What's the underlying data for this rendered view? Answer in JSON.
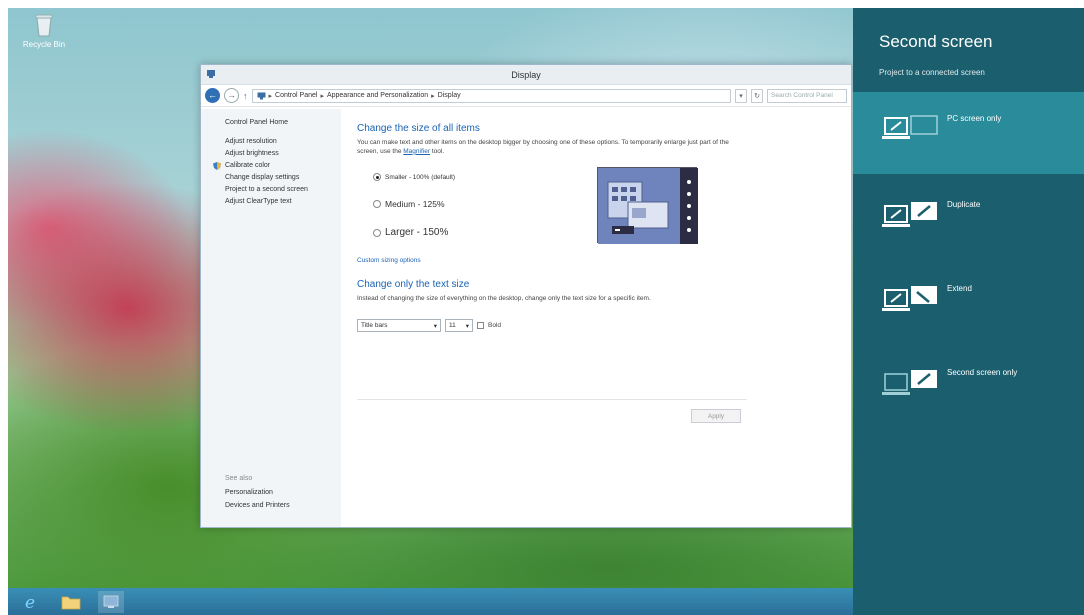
{
  "desktop": {
    "icon_label": "Recycle Bin"
  },
  "window": {
    "title": "Display",
    "address": {
      "path": [
        "Control Panel",
        "Appearance and Personalization",
        "Display"
      ],
      "search_placeholder": "Search Control Panel"
    },
    "left_pane": {
      "home": "Control Panel Home",
      "links": [
        "Adjust resolution",
        "Adjust brightness",
        "Calibrate color",
        "Change display settings",
        "Project to a second screen",
        "Adjust ClearType text"
      ],
      "see_also_heading": "See also",
      "see_also": [
        "Personalization",
        "Devices and Printers"
      ]
    },
    "main": {
      "section1_title": "Change the size of all items",
      "section1_desc_part1": "You can make text and other items on the desktop bigger by choosing one of these options. To temporarily enlarge just part of the screen, use the",
      "section1_desc_link": "Magnifier",
      "section1_desc_part2": "tool.",
      "options": [
        {
          "label": "Smaller - 100% (default)",
          "selected": true
        },
        {
          "label": "Medium - 125%",
          "selected": false
        },
        {
          "label": "Larger - 150%",
          "selected": false
        }
      ],
      "custom_link": "Custom sizing options",
      "section2_title": "Change only the text size",
      "section2_desc": "Instead of changing the size of everything on the desktop, change only the text size for a specific item.",
      "item_select": "Title bars",
      "size_select": "11",
      "bold_label": "Bold",
      "apply_label": "Apply"
    }
  },
  "charm": {
    "title": "Second screen",
    "subtitle": "Project to a connected screen",
    "options": [
      {
        "label": "PC screen only",
        "selected": true
      },
      {
        "label": "Duplicate",
        "selected": false
      },
      {
        "label": "Extend",
        "selected": false
      },
      {
        "label": "Second screen only",
        "selected": false
      }
    ]
  },
  "colors": {
    "charm_bg": "#1b5e6e",
    "charm_selected": "#2a8c9a",
    "link_blue": "#1b63b3",
    "taskbar": "#2a6f98"
  }
}
